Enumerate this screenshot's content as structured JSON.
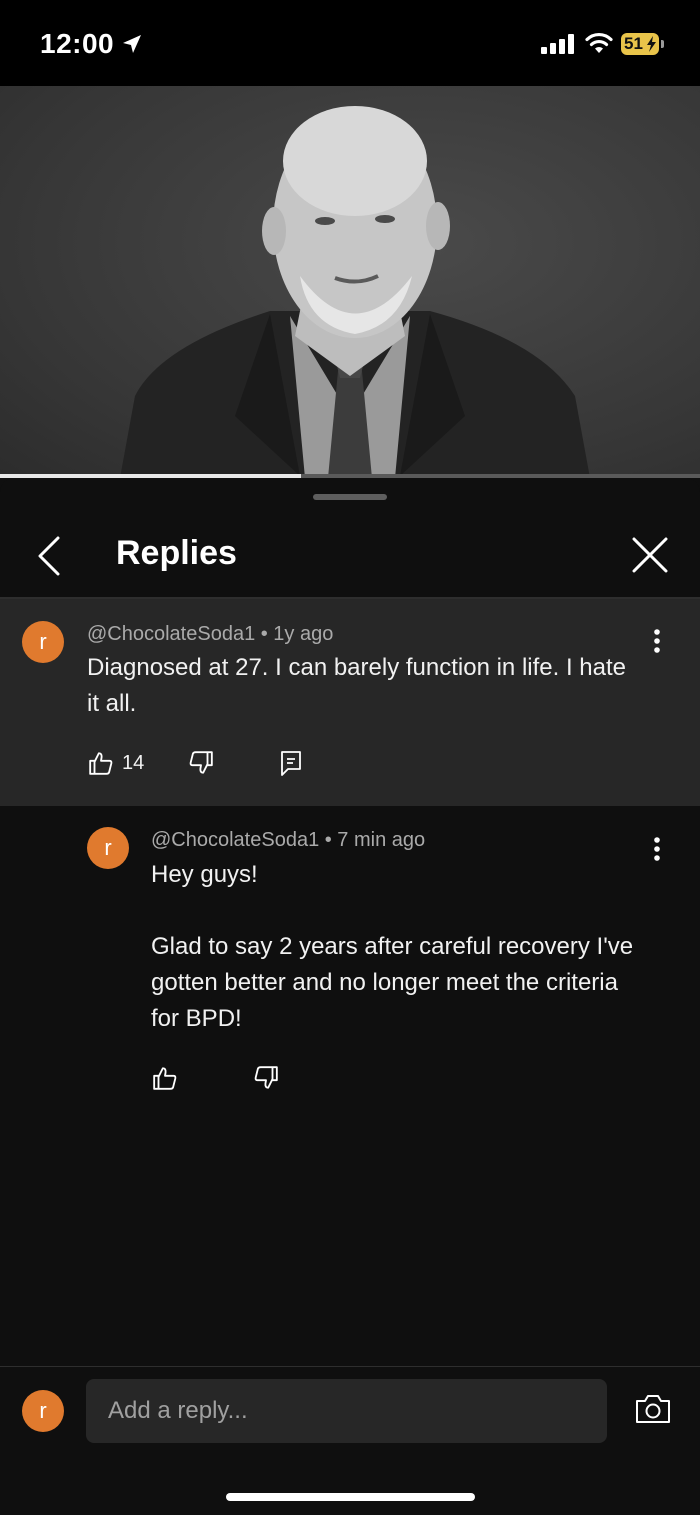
{
  "status_bar": {
    "time": "12:00",
    "battery": "51"
  },
  "video": {
    "progress_fraction": 0.43
  },
  "header": {
    "title": "Replies"
  },
  "parent_comment": {
    "avatar_letter": "r",
    "meta": "@ChocolateSoda1 • 1y ago",
    "text": "Diagnosed at 27. I can barely function in life. I hate it all.",
    "likes": "14"
  },
  "reply": {
    "avatar_letter": "r",
    "meta": "@ChocolateSoda1 • 7 min ago",
    "line1": "Hey guys!",
    "line2": "Glad to say 2 years after careful recovery I've gotten better and no longer meet the criteria for BPD!"
  },
  "composer": {
    "avatar_letter": "r",
    "placeholder": "Add a reply..."
  },
  "colors": {
    "avatar": "#e07a2e",
    "highlight_bg": "#272727",
    "sheet_bg": "#0f0f0f",
    "battery": "#e9c44a"
  },
  "icons": [
    "location-arrow-icon",
    "signal-icon",
    "wifi-icon",
    "back-chevron-icon",
    "close-icon",
    "more-vert-icon",
    "thumbs-up-icon",
    "thumbs-down-icon",
    "reply-comment-icon",
    "camera-icon"
  ]
}
